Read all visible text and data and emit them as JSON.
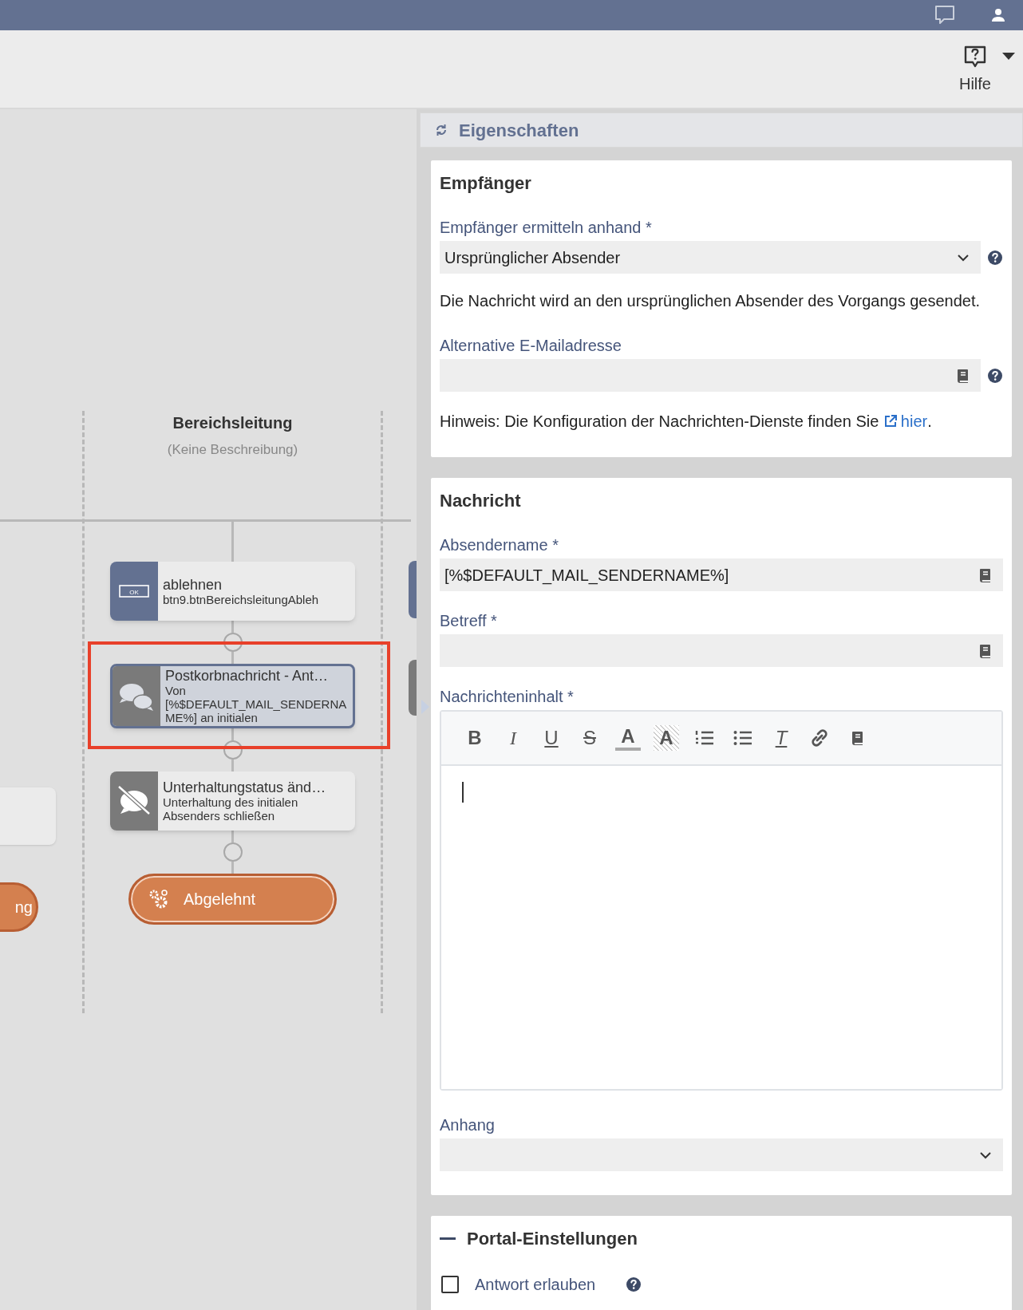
{
  "toolbar": {
    "help_label": "Hilfe"
  },
  "canvas": {
    "lane": {
      "title": "Bereichsleitung",
      "description": "(Keine Beschreibung)"
    },
    "left_partial": {
      "end_label": "ng"
    },
    "nodes": [
      {
        "kind": "button-task",
        "icon_text": "OK",
        "title": "ablehnen",
        "subtitle": "btn9.btnBereichsleitungAbleh",
        "selected": false,
        "highlighted": false
      },
      {
        "kind": "message-task",
        "title": "Postkorbnachricht - Ant…",
        "subtitle": "Von [%$DEFAULT_MAIL_SENDERNAME%] an initialen",
        "selected": true,
        "highlighted": true
      },
      {
        "kind": "status-task",
        "title": "Unterhaltungstatus änd…",
        "subtitle": "Unterhaltung des initialen Absenders schließen",
        "selected": false,
        "highlighted": false
      },
      {
        "kind": "end-event",
        "title": "Abgelehnt",
        "selected": false,
        "highlighted": false
      }
    ]
  },
  "panel": {
    "title": "Eigenschaften",
    "sections": [
      {
        "title": "Empfänger",
        "collapsible": false,
        "items": [
          {
            "kind": "select",
            "label": "Empfänger ermitteln anhand *",
            "value": "Ursprünglicher Absender",
            "help": true
          },
          {
            "kind": "text",
            "text": "Die Nachricht wird an den ursprünglichen Absender des Vorgangs gesendet."
          },
          {
            "kind": "field",
            "label": "Alternative E-Mailadresse",
            "value": "",
            "help": true
          },
          {
            "kind": "hint",
            "text": "Hinweis: Die Konfiguration der Nachrichten-Dienste finden Sie",
            "link": "hier",
            "after": "."
          }
        ]
      },
      {
        "title": "Nachricht",
        "collapsible": false,
        "items": [
          {
            "kind": "field",
            "label": "Absendername *",
            "value": "[%$DEFAULT_MAIL_SENDERNAME%]",
            "help": false
          },
          {
            "kind": "field",
            "label": "Betreff *",
            "value": "",
            "help": false
          },
          {
            "kind": "editor",
            "label": "Nachrichteninhalt *",
            "tools": [
              {
                "kind": "bold",
                "label": "B"
              },
              {
                "kind": "italic",
                "label": "I"
              },
              {
                "kind": "underline",
                "label": "U"
              },
              {
                "kind": "strike",
                "label": "S"
              },
              {
                "kind": "font-color",
                "label": "A"
              },
              {
                "kind": "highlight-color",
                "label": "A"
              },
              {
                "kind": "ordered-list"
              },
              {
                "kind": "bullet-list"
              },
              {
                "kind": "clear-format",
                "label": "T"
              },
              {
                "kind": "link"
              },
              {
                "kind": "book"
              }
            ]
          },
          {
            "kind": "select",
            "label": "Anhang",
            "value": "",
            "help": false
          }
        ]
      },
      {
        "title": "Portal-Einstellungen",
        "collapsible": true,
        "items": [
          {
            "kind": "checkbox",
            "label": "Antwort erlauben",
            "checked": false,
            "help": true
          }
        ]
      }
    ]
  }
}
